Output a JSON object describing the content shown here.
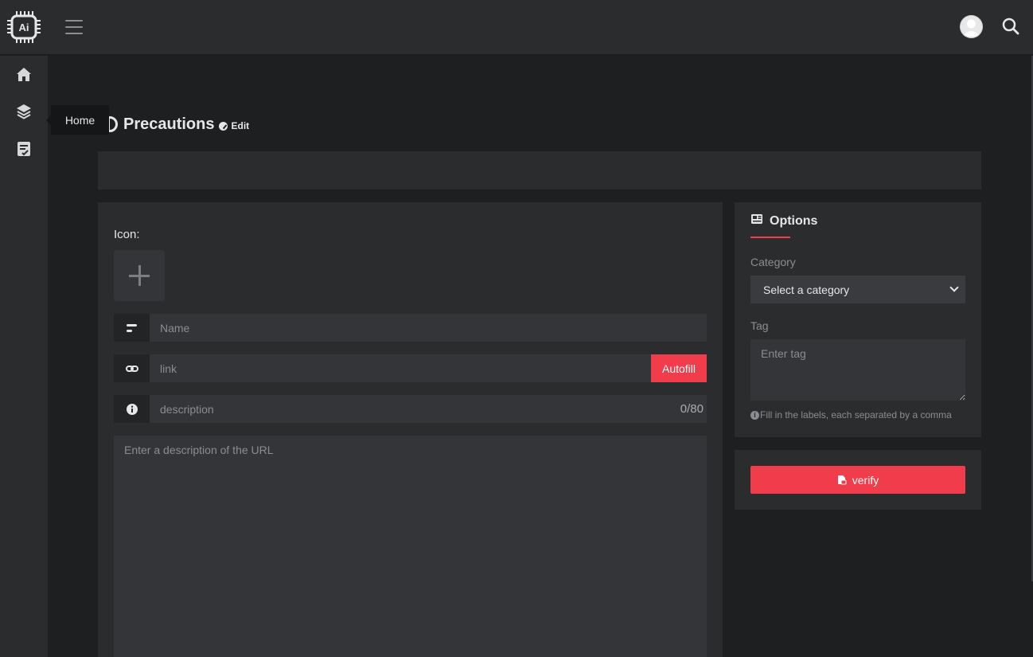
{
  "header": {
    "logo_icon": "ai-chip-logo",
    "menu_icon": "hamburger-icon",
    "avatar_icon": "user-avatar",
    "search_icon": "search-icon"
  },
  "sidebar": {
    "items": [
      {
        "name": "home",
        "icon": "home-icon"
      },
      {
        "name": "layers",
        "icon": "layers-icon"
      },
      {
        "name": "submit",
        "icon": "clipboard-check-icon"
      }
    ],
    "tooltip": "Home"
  },
  "page": {
    "title": "Precautions",
    "edit_label": "Edit"
  },
  "form": {
    "icon_label": "Icon:",
    "name_placeholder": "Name",
    "link_placeholder": "link",
    "autofill_label": "Autofill",
    "description_placeholder": "description",
    "description_counter": "0/80",
    "details_placeholder": "Enter a description of the URL"
  },
  "options": {
    "title": "Options",
    "category_label": "Category",
    "category_selected": "Select a category",
    "tag_label": "Tag",
    "tag_placeholder": "Enter tag",
    "hint": "Fill in the labels, each separated by a comma"
  },
  "verify": {
    "label": "verify"
  },
  "colors": {
    "accent": "#f03c4b",
    "background": "#1e1f21",
    "panel": "#2b2c2e"
  }
}
